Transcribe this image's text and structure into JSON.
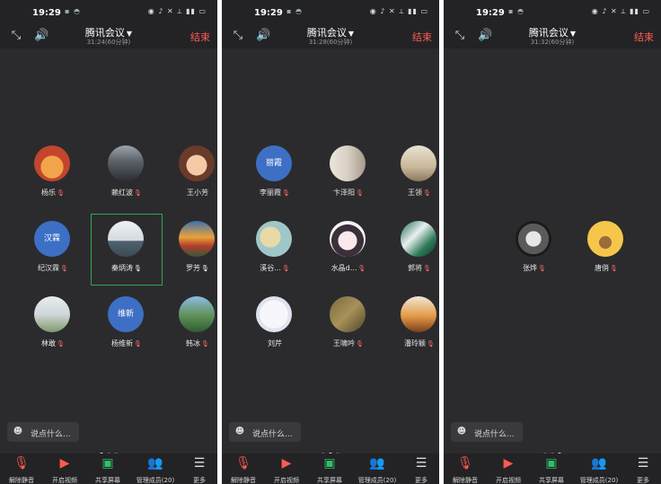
{
  "status": {
    "time": "19:29"
  },
  "meeting": {
    "title": "腾讯会议",
    "end_label": "结束"
  },
  "chat": {
    "placeholder": "说点什么..."
  },
  "toolbar": {
    "unmute": "解除静音",
    "video": "开启视频",
    "share": "共享屏幕",
    "members": "管理成员(20)",
    "more": "更多"
  },
  "colors": {
    "background": "#2b2b2e",
    "end": "#ff5a4f",
    "share": "#2fbd6b",
    "highlight": "#2fa84f",
    "avatar_text_bg": "#3d6fc4"
  },
  "panels": [
    {
      "duration": "31:24(60分钟)",
      "active_dot": 0,
      "participants": [
        {
          "name": "杨乐",
          "mic": "muted",
          "avatar_text": "",
          "avatar": "cartoon-dog"
        },
        {
          "name": "赖红波",
          "mic": "muted",
          "avatar_text": "",
          "avatar": "man-photo"
        },
        {
          "name": "王小芳",
          "mic": "none",
          "avatar_text": "",
          "avatar": "girl-cartoon"
        },
        {
          "name": "纪汉霖",
          "mic": "muted",
          "avatar_text": "汉霖",
          "avatar": "text"
        },
        {
          "name": "秦炳涛",
          "mic": "on",
          "avatar_text": "",
          "avatar": "jet",
          "highlight": true
        },
        {
          "name": "罗芳",
          "mic": "on",
          "avatar_text": "",
          "avatar": "landscape-colorful"
        },
        {
          "name": "林敢",
          "mic": "muted",
          "avatar_text": "",
          "avatar": "goat"
        },
        {
          "name": "杨维新",
          "mic": "muted",
          "avatar_text": "维新",
          "avatar": "text"
        },
        {
          "name": "韩冰",
          "mic": "muted",
          "avatar_text": "",
          "avatar": "mountain"
        }
      ]
    },
    {
      "duration": "31:28(60分钟)",
      "active_dot": 1,
      "participants": [
        {
          "name": "李丽霞",
          "mic": "muted",
          "avatar_text": "丽霞",
          "avatar": "text"
        },
        {
          "name": "卞泽阳",
          "mic": "muted",
          "avatar_text": "",
          "avatar": "room"
        },
        {
          "name": "王领",
          "mic": "muted",
          "avatar_text": "",
          "avatar": "photo-light"
        },
        {
          "name": "溪谷...",
          "mic": "muted",
          "avatar_text": "",
          "avatar": "map"
        },
        {
          "name": "水晶d...",
          "mic": "muted",
          "avatar_text": "",
          "avatar": "anime-girl"
        },
        {
          "name": "郭将",
          "mic": "muted",
          "avatar_text": "",
          "avatar": "waterfall"
        },
        {
          "name": "刘芹",
          "mic": "none",
          "avatar_text": "",
          "avatar": "cartoon-white"
        },
        {
          "name": "王啸吟",
          "mic": "muted",
          "avatar_text": "",
          "avatar": "painting"
        },
        {
          "name": "潘玲颖",
          "mic": "muted",
          "avatar_text": "",
          "avatar": "tiger"
        }
      ]
    },
    {
      "duration": "31:32(60分钟)",
      "active_dot": 2,
      "participants": [
        {
          "name": "张烨",
          "mic": "muted",
          "avatar_text": "",
          "avatar": "bw-art"
        },
        {
          "name": "唐俏",
          "mic": "muted",
          "avatar_text": "",
          "avatar": "flower-pot"
        }
      ]
    }
  ]
}
